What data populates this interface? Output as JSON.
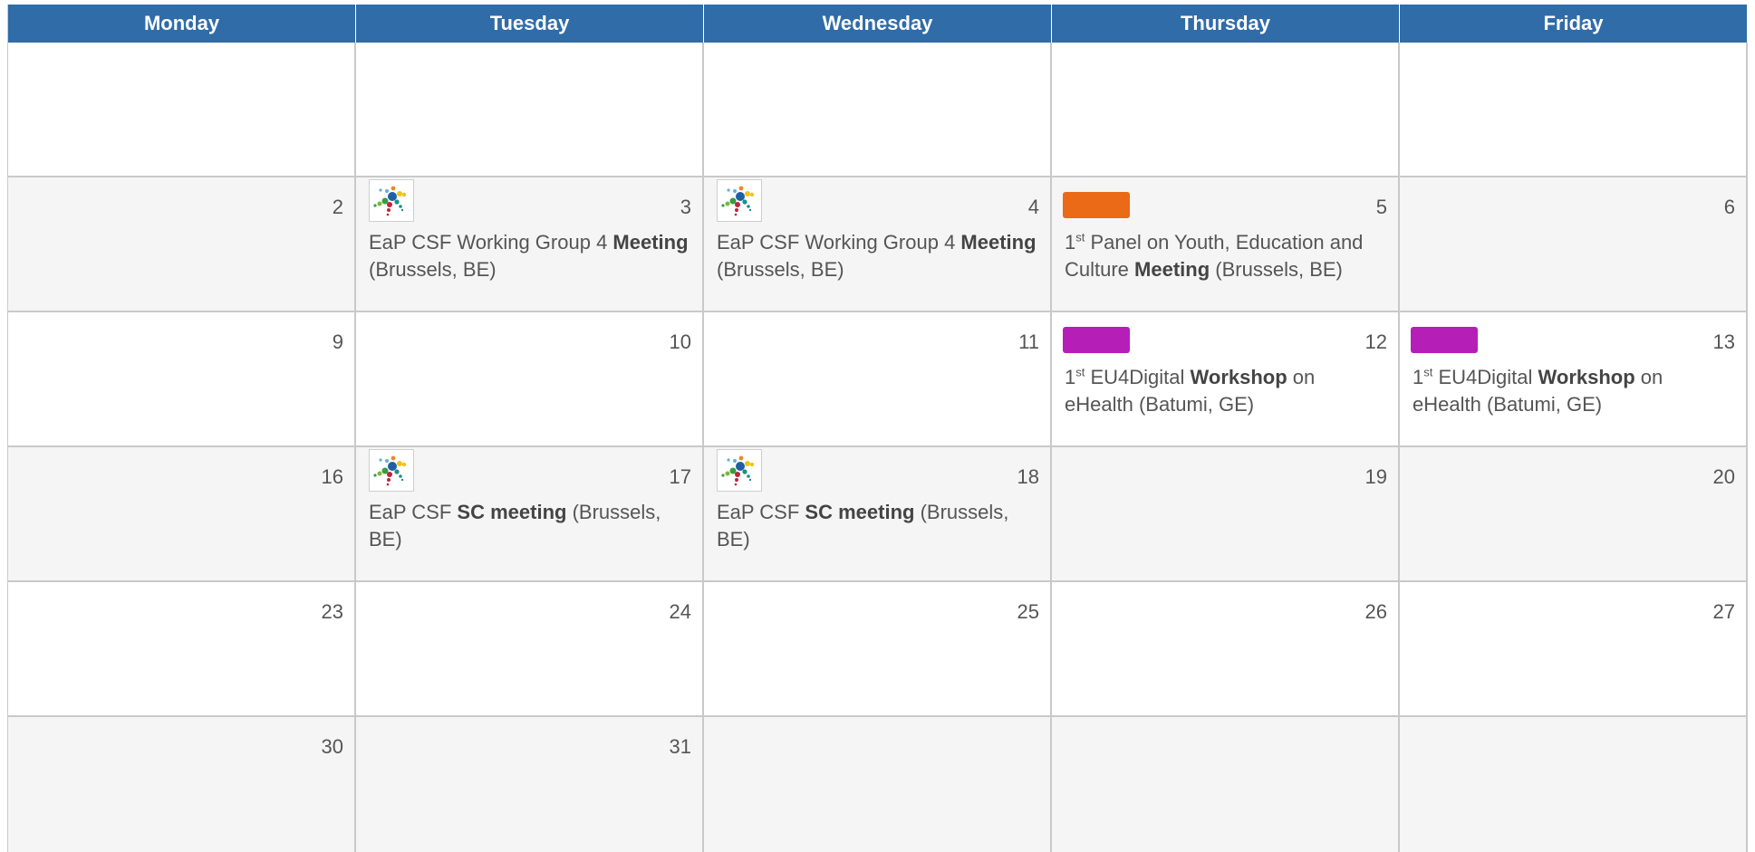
{
  "colors": {
    "header": "#2f6ca8",
    "orange_tag": "#ea6a17",
    "magenta_tag": "#b51fb8"
  },
  "headers": [
    "Monday",
    "Tuesday",
    "Wednesday",
    "Thursday",
    "Friday"
  ],
  "weeks": [
    [
      {
        "day": ""
      },
      {
        "day": ""
      },
      {
        "day": ""
      },
      {
        "day": ""
      },
      {
        "day": ""
      }
    ],
    [
      {
        "day": "2"
      },
      {
        "day": "3",
        "icon": "eap-csf-logo-icon",
        "event": {
          "pre": "EaP CSF Working Group 4 ",
          "bold": "Meeting",
          "post": " (Brussels, BE)"
        }
      },
      {
        "day": "4",
        "icon": "eap-csf-logo-icon",
        "event": {
          "pre": "EaP CSF Working Group 4 ",
          "bold": "Meeting",
          "post": " (Brussels, BE)"
        }
      },
      {
        "day": "5",
        "tag": "orange",
        "event": {
          "num": "1",
          "sup": "st",
          "pre": " Panel on Youth, Education and Culture ",
          "bold": "Meeting",
          "post": " (Brussels, BE)"
        }
      },
      {
        "day": "6"
      }
    ],
    [
      {
        "day": "9"
      },
      {
        "day": "10"
      },
      {
        "day": "11"
      },
      {
        "day": "12",
        "tag": "magenta",
        "event": {
          "num": "1",
          "sup": "st",
          "pre": " EU4Digital ",
          "bold": "Workshop",
          "post": " on eHealth (Batumi, GE)"
        }
      },
      {
        "day": "13",
        "tag": "magenta",
        "event": {
          "num": "1",
          "sup": "st",
          "pre": " EU4Digital ",
          "bold": "Workshop",
          "post": " on eHealth (Batumi, GE)"
        }
      }
    ],
    [
      {
        "day": "16"
      },
      {
        "day": "17",
        "icon": "eap-csf-logo-icon",
        "event": {
          "pre": "EaP CSF ",
          "bold": "SC meeting",
          "post": " (Brussels, BE)"
        }
      },
      {
        "day": "18",
        "icon": "eap-csf-logo-icon",
        "event": {
          "pre": "EaP CSF ",
          "bold": "SC meeting",
          "post": " (Brussels, BE)"
        }
      },
      {
        "day": "19"
      },
      {
        "day": "20"
      }
    ],
    [
      {
        "day": "23"
      },
      {
        "day": "24"
      },
      {
        "day": "25"
      },
      {
        "day": "26"
      },
      {
        "day": "27"
      }
    ],
    [
      {
        "day": "30"
      },
      {
        "day": "31"
      },
      {
        "day": ""
      },
      {
        "day": ""
      },
      {
        "day": ""
      }
    ]
  ]
}
